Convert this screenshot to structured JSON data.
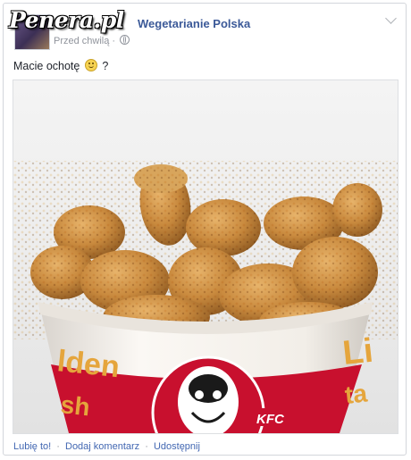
{
  "watermark": "Penera.pl",
  "post": {
    "page_name": "Wegetarianie Polska",
    "time": "Przed chwilą",
    "text_before_emoji": "Macie ochotę",
    "text_after_emoji": " ?",
    "emoji_icon": "smile-icon",
    "privacy_icon": "globe-icon"
  },
  "photo": {
    "bucket_left_text": "lden",
    "bucket_left_text2": "sh",
    "bucket_right_text": "Li",
    "bucket_right_text2": "ta",
    "brand_text": "KFC",
    "colors": {
      "bucket_red": "#c8102e",
      "bucket_white": "#f7f3ee",
      "chicken": "#c98a3e",
      "chicken_dark": "#8e5a22",
      "bucket_text_gold": "#e5a53c"
    }
  },
  "actions": {
    "like": "Lubię to!",
    "comment": "Dodaj komentarz",
    "share": "Udostępnij",
    "separator": "·"
  },
  "colors": {
    "link_blue": "#3b5998",
    "meta_gray": "#90949c"
  }
}
